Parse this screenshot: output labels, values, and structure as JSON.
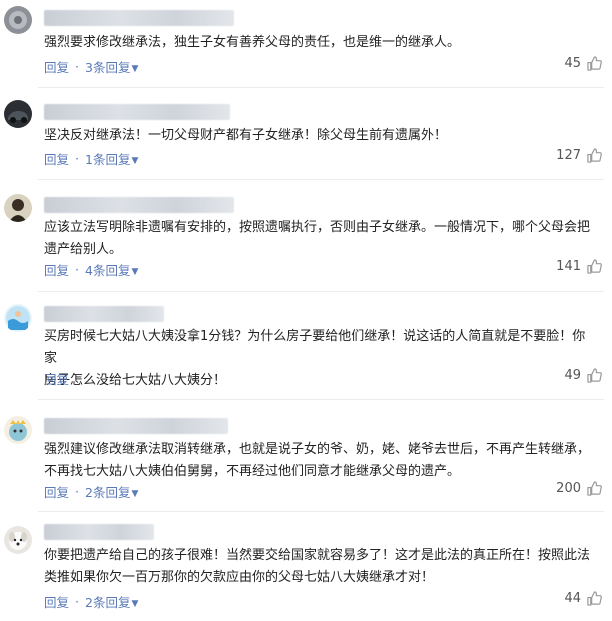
{
  "comments": [
    {
      "text": "强烈要求修改继承法，独生子女有善养父母的责任，也是维一的继承人。",
      "reply_label": "回复",
      "sub_replies": "3条回复",
      "likes": "45",
      "avatar_icon": "avatar-grey-pattern-icon"
    },
    {
      "text": "坚决反对继承法！一切父母财产都有子女继承！除父母生前有遗属外！",
      "reply_label": "回复",
      "sub_replies": "1条回复",
      "likes": "127",
      "avatar_icon": "avatar-car-icon"
    },
    {
      "text": "应该立法写明除非遗嘱有安排的，按照遗嘱执行，否则由子女继承。一般情况下，哪个父母会把\n遗产给别人。",
      "reply_label": "回复",
      "sub_replies": "4条回复",
      "likes": "141",
      "avatar_icon": "avatar-person-icon"
    },
    {
      "text": "买房时候七大姑八大姨没拿1分钱？为什么房子要给他们继承！说这话的人简直就是不要脸！你家\n房子怎么没给七大姑八大姨分！",
      "reply_label": "回复",
      "sub_replies": "",
      "likes": "49",
      "avatar_icon": "avatar-swimmer-icon"
    },
    {
      "text": "强烈建议修改继承法取消转继承，也就是说子女的爷、奶，姥、姥爷去世后，不再产生转继承，\n不再找七大姑八大姨伯伯舅舅，不再经过他们同意才能继承父母的遗产。",
      "reply_label": "回复",
      "sub_replies": "2条回复",
      "likes": "200",
      "avatar_icon": "avatar-cartoon-icon"
    },
    {
      "text": "你要把遗产给自己的孩子很难！当然要交给国家就容易多了！这才是此法的真正所在！按照此法\n类推如果你欠一百万那你的欠款应由你的父母七姑八大姨继承才对！",
      "reply_label": "回复",
      "sub_replies": "2条回复",
      "likes": "44",
      "avatar_icon": "avatar-dog-icon"
    }
  ],
  "colors": {
    "link": "#5a79b8",
    "text": "#222222",
    "like_icon": "#9a9a9a"
  }
}
